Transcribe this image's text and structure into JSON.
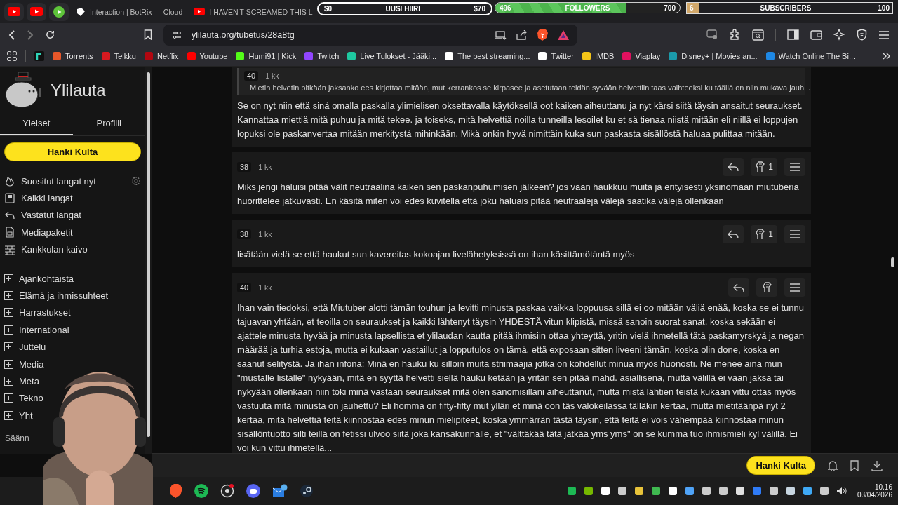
{
  "browser": {
    "tabs": [
      {
        "title": "Interaction | BotRix — Cloud",
        "selected": false
      },
      {
        "title": "I HAVEN'T SCREAMED THIS L",
        "selected": false
      }
    ],
    "goal_widget": {
      "start": "$0",
      "label": "UUSI HIIRI",
      "target": "$70"
    },
    "followers_widget": {
      "current": "496",
      "label": "FOLLOWERS",
      "target": "700",
      "level": 0.71
    },
    "subscribers_widget": {
      "current": "6",
      "label": "SUBSCRIBERS",
      "target": "100",
      "level": 0.06
    },
    "url": "ylilauta.org/tubetus/28a8tg",
    "bookmarks": [
      "Torrents",
      "Telkku",
      "Netflix",
      "Youtube",
      "Humi91 | Kick",
      "Twitch",
      "Live Tulokset - Jääki...",
      "The best streaming...",
      "Twitter",
      "IMDB",
      "Viaplay",
      "Disney+ | Movies an...",
      "Watch Online The Bi..."
    ]
  },
  "sidebar": {
    "site_name": "Ylilauta",
    "tabs": [
      {
        "label": "Yleiset",
        "selected": true
      },
      {
        "label": "Profiili",
        "selected": false
      }
    ],
    "gold_button": "Hanki Kulta",
    "nav": [
      "Suositut langat nyt",
      "Kaikki langat",
      "Vastatut langat",
      "Mediapaketit",
      "Kankkulan kaivo"
    ],
    "boards": [
      "Ajankohtaista",
      "Elämä ja ihmissuhteet",
      "Harrastukset",
      "International",
      "Juttelu",
      "Media",
      "Meta",
      "Tekno",
      "Yht"
    ],
    "footer": "Säänn"
  },
  "posts": [
    {
      "quote": {
        "number": "40",
        "age": "1 kk",
        "text": "Mietin helvetin pitkään jaksanko ees kirjottaa mitään, mut kerrankos se kirpasee ja asetutaan teidän syvään helvettiin taas vaihteeksi ku täällä on niin mukava jauh..."
      },
      "text": "Se on nyt niin että sinä omalla paskalla ylimielisen oksettavalla käytöksellä oot kaiken aiheuttanu ja nyt kärsi siitä täysin ansaitut seuraukset. Kannattaa miettiä mitä puhuu ja mitä tekee. ja toiseks, mitä helvettiä noilla tunneilla lesoilet ku et sä tienaa niistä mitään eli niillä ei loppujen lopuksi ole paskanvertaa mitään merkitystä mihinkään. Mikä onkin hyvä nimittäin kuka sun paskasta sisällöstä haluaa pulittaa mitään."
    },
    {
      "number": "38",
      "age": "1 kk",
      "reactions": "1",
      "text": "Miks jengi haluisi pitää välit neutraalina kaiken sen paskanpuhumisen jälkeen? jos vaan haukkuu muita ja erityisesti yksinomaan miutuberia huorittelee jatkuvasti. En käsitä miten voi edes kuvitella että joku haluais pitää neutraaleja välejä saatika välejä ollenkaan"
    },
    {
      "number": "38",
      "age": "1 kk",
      "reactions": "1",
      "text": "lisätään vielä se että haukut sun kavereitas kokoajan livelähetyksissä on ihan käsittämötäntä myös"
    },
    {
      "number": "40",
      "age": "1 kk",
      "text": "Ihan vain tiedoksi, että Miutuber alotti tämän touhun ja levitti minusta paskaa vaikka loppuusa sillä ei oo mitään väliä enää, koska se ei tunnu tajuavan yhtään, et teoilla on seuraukset ja kaikki lähtenyt täysin YHDESTÄ vitun klipistä, missä sanoin suorat sanat, koska sekään ei ajattele minusta hyvää ja minusta lapsellista et ylilaudan kautta pitää ihmisiin ottaa yhteyttä, yritin vielä ihmetellä tätä paskamyrskyä ja negan määrää ja turhia estoja, mutta ei kukaan vastaillut ja lopputulos on tämä, että exposaan sitten liveeni tämän, koska olin done, koska en saanut selitystä. Ja ihan infona: Minä en hauku ku silloin muita striimaajia jotka on kohdellut minua myös huonosti. Ne menee aina mun \"mustalle listalle\" nykyään, mitä en syyttä helvetti siellä hauku ketään ja yritän sen pitää mahd. asiallisena, mutta välillä ei vaan jaksa tai nykyään ollenkaan niin toki minä vastaan seuraukset mitä olen sanomisillani aiheuttanut, mutta mistä lähtien teistä kukaan vittu ottas myös vastuuta mitä minusta on jauhettu? Eli homma on fifty-fifty mut ylläri et minä oon täs valokeilassa tälläkin kertaa, mutta mietitäänpä nyt 2 kertaa, mitä helvettiä teitä kiinnostaa edes minun mielipiteet, koska ymmärrän tästä täysin, että teitä ei vois vähempää kiinnostaa minun sisällöntuotto silti teillä on fetissi ulvoo siitä joka kansakunnalle, et \"välttäkää tätä jätkää yms yms\" on se kumma tuo ihmismieli kyl välillä. Ei voi kun vittu ihmetellä..."
    }
  ],
  "bottom_bar": {
    "gold_button": "Hanki Kulta"
  },
  "taskbar": {
    "time": "10.16",
    "date": "03/04/2026"
  }
}
